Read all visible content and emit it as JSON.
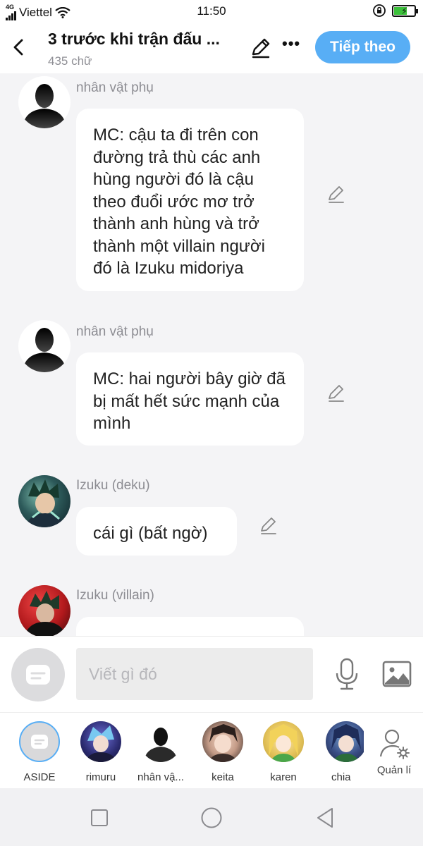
{
  "status_bar": {
    "network": "4G",
    "carrier": "Viettel",
    "time": "11:50"
  },
  "header": {
    "title": "3 trước khi trận đấu ...",
    "word_count": "435 chữ",
    "next_label": "Tiếp theo"
  },
  "messages": [
    {
      "name": "nhân vật phụ",
      "avatar": "silhouette-avatar",
      "text": "MC: cậu ta đi trên con đường trả thù các anh hùng người đó là cậu theo đuổi ước mơ trở thành anh hùng và trở thành một villain người đó là Izuku midoriya"
    },
    {
      "name": "nhân vật phụ",
      "avatar": "silhouette-avatar",
      "text": "MC: hai người bây giờ đã bị mất hết sức mạnh của mình"
    },
    {
      "name": "Izuku (deku)",
      "avatar": "deku-avatar",
      "text": "cái gì (bất ngờ)"
    },
    {
      "name": "Izuku (villain)",
      "avatar": "villain-avatar",
      "text": ""
    }
  ],
  "input": {
    "placeholder": "Viết gì đó"
  },
  "characters": [
    {
      "label": "ASIDE",
      "avatar": "aside-icon"
    },
    {
      "label": "rimuru",
      "avatar": "rimuru-avatar"
    },
    {
      "label": "nhân vậ...",
      "avatar": "silhouette-avatar"
    },
    {
      "label": "keita",
      "avatar": "keita-avatar"
    },
    {
      "label": "karen",
      "avatar": "karen-avatar"
    },
    {
      "label": "chia",
      "avatar": "chia-avatar"
    }
  ],
  "manage_label": "Quản lí",
  "colors": {
    "accent": "#58aef5",
    "background": "#f4f4f6",
    "name_text": "#8c8c92"
  }
}
